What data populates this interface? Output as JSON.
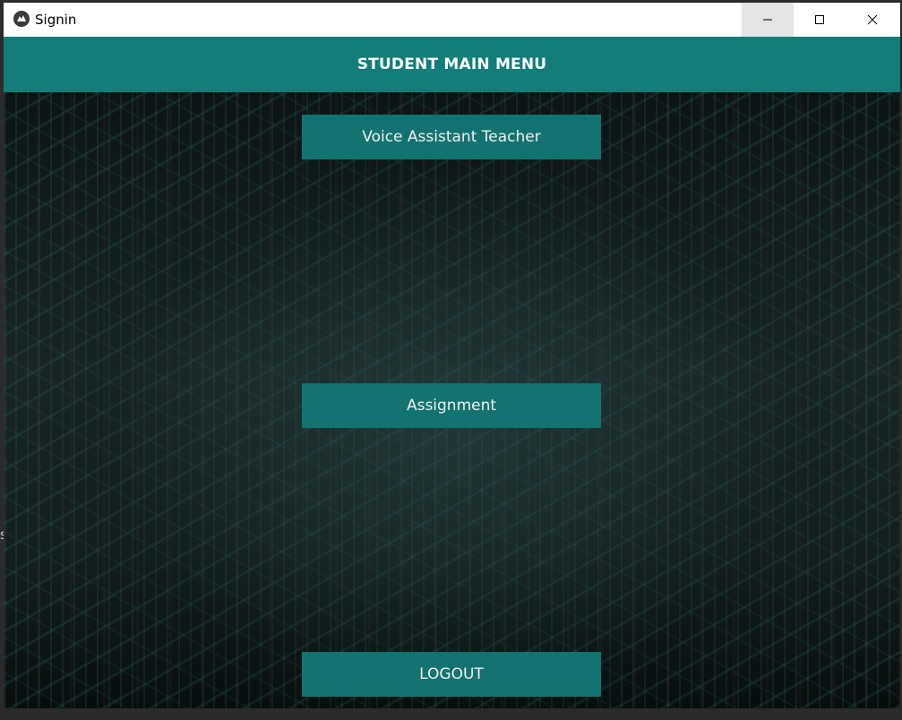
{
  "window": {
    "title": "Signin",
    "icon": "kivy-logo-icon"
  },
  "header": {
    "title": "STUDENT MAIN MENU"
  },
  "menu": {
    "voice_assistant_label": "Voice Assistant Teacher",
    "assignment_label": "Assignment",
    "logout_label": "LOGOUT"
  },
  "background_edge_text": "s",
  "colors": {
    "accent": "#127d79",
    "button": "#127371",
    "button_text": "#f2f2f2"
  }
}
